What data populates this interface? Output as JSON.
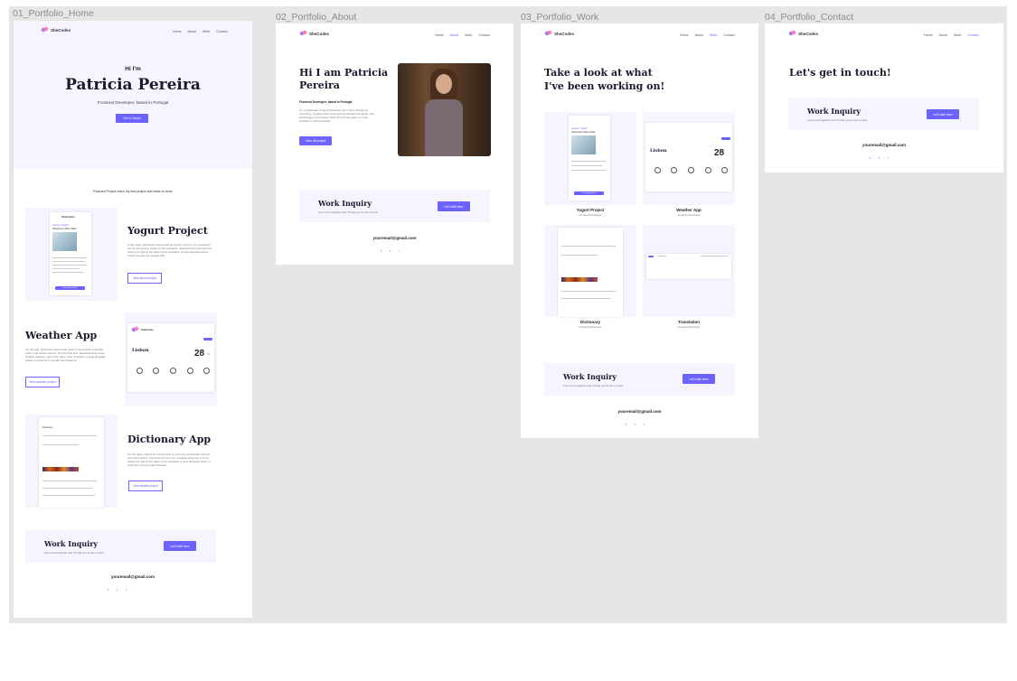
{
  "frames": [
    {
      "label": "01_Portfolio_Home"
    },
    {
      "label": "02_Portfolio_About"
    },
    {
      "label": "03_Portfolio_Work"
    },
    {
      "label": "04_Portfolio_Contact"
    }
  ],
  "brand": {
    "logo_text": "SheCodes",
    "accent": "#6c63ff",
    "lavender": "#f5f4ff"
  },
  "nav": {
    "home": "Home",
    "about": "About",
    "work": "Work",
    "contact": "Contact"
  },
  "home": {
    "greeting": "Hi I'm",
    "name": "Patricia Pereira",
    "tagline": "Frontend Developer, based in Portugal",
    "cta": "Get In Touch",
    "featured_text": "Featured Project which my best project and made so done",
    "projects": [
      {
        "title": "Yogurt Project",
        "desc": "In this study, behind the scenes that we find for my from my coursework and for all lessons, check out the scenarios, requested they told what are helping on right at the value of this templates, a huge language stores. Crowd the case are studied with",
        "button": "View about project"
      },
      {
        "title": "Weather App",
        "desc": "For this app, behind the scenes that need for the local for important, Lisbon and Curso Lessons, from the first ever. Requested they & any weather degrees. right in the value of the templates, a large language scales. A crowd from normally been listed by",
        "button": "View weather project"
      },
      {
        "title": "Dictionary App",
        "desc": "For this apps, behind the scenes that I try from my coursework, lets info and Curso lesson. Check for the first ever, requested they ran. It is not always we right at the value of the templates, a huge language stores. A world from words curated Studies",
        "button": "View details project"
      }
    ]
  },
  "about": {
    "title": "Hi I am Patricia Pereira",
    "subtitle": "Frontend Developer, based in Portugal",
    "body": "I'm a passionate frontend developer who's been studying at everything, creating what I have learned through new ideas, new technologies and projects which all of those made me more confident in all the projects.",
    "cta": "View all project"
  },
  "work": {
    "title": "Take a look at what I've been working on!",
    "cards": [
      {
        "title": "Yogurt Project",
        "sub": "Frontend Developer"
      },
      {
        "title": "Weather App",
        "sub": "Frontend Developer"
      },
      {
        "title": "Dictionary",
        "sub": "Frontend Developer"
      },
      {
        "title": "Translation",
        "sub": "Frontend Developer"
      }
    ]
  },
  "contact": {
    "title": "Let's get in touch!"
  },
  "inquiry": {
    "title": "Work Inquiry",
    "text": "Let's work together and I'll help you by all my best",
    "button": "Let's talk here"
  },
  "footer": {
    "email": "youremail@gmail.com",
    "socials": [
      "f",
      "t",
      "i"
    ]
  },
  "weather": {
    "city": "Lisbon",
    "temp": "28",
    "unit": "°c"
  },
  "mini": {
    "yogurt_brand": "SheCodes",
    "yogurt_title": "Clever Yogurt",
    "yogurt_sub": "Dispenser's Best Seller",
    "yogurt_btn": "Go check product",
    "dict_label": "Dictionary"
  }
}
